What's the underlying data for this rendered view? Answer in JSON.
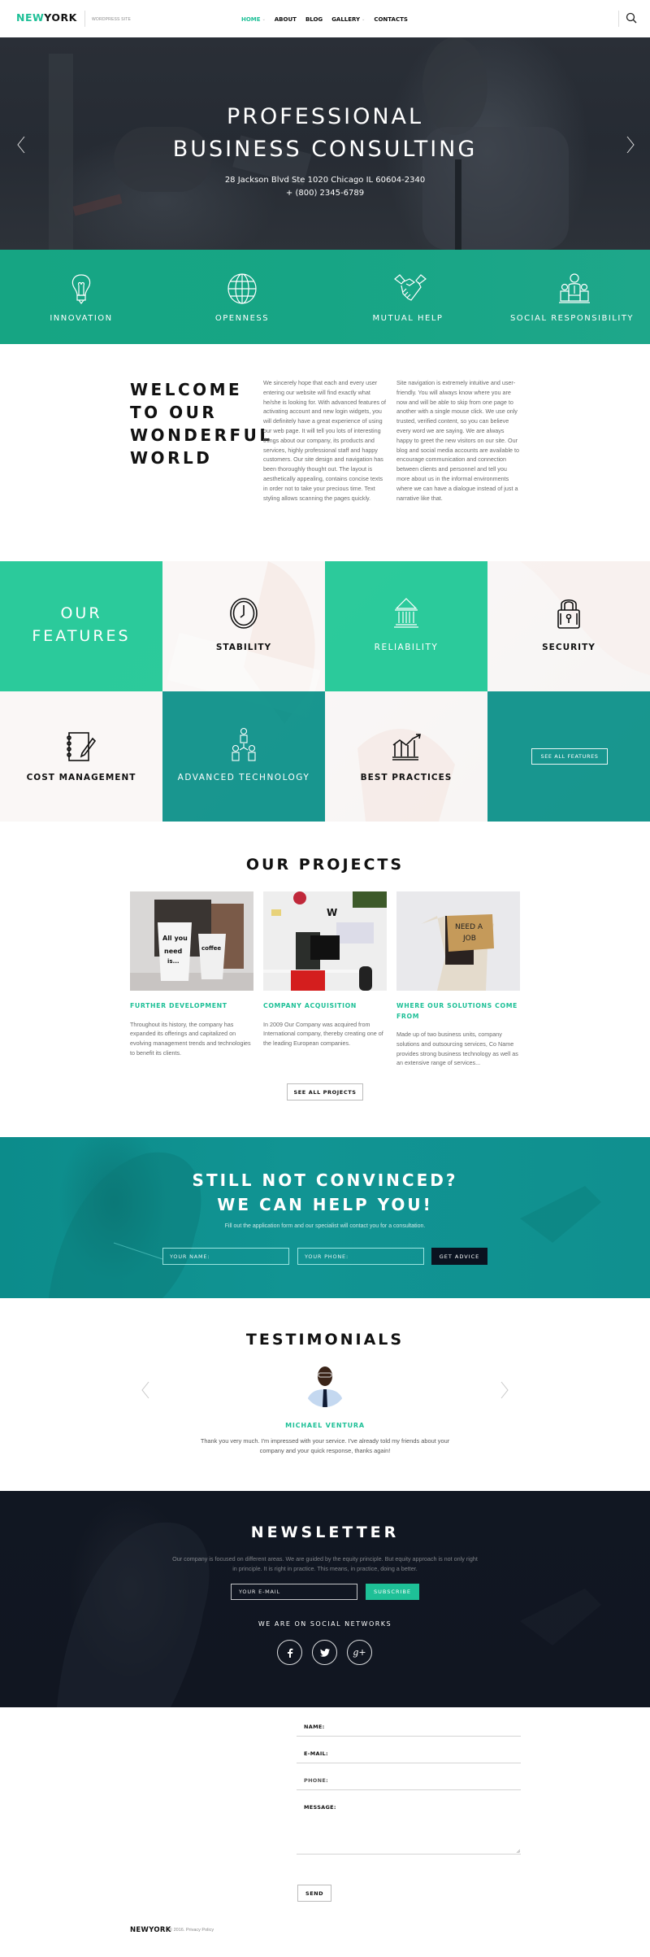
{
  "header": {
    "logo_accent": "NEW",
    "logo_main": "YORK",
    "tagline": "WORDPRESS SITE",
    "nav": [
      {
        "label": "HOME",
        "active": true,
        "has_dropdown": true
      },
      {
        "label": "ABOUT",
        "active": false,
        "has_dropdown": false
      },
      {
        "label": "BLOG",
        "active": false,
        "has_dropdown": false
      },
      {
        "label": "GALLERY",
        "active": false,
        "has_dropdown": true
      },
      {
        "label": "CONTACTS",
        "active": false,
        "has_dropdown": false
      }
    ],
    "search_icon": "search-icon"
  },
  "hero": {
    "title_line1": "PROFESSIONAL",
    "title_line2": "BUSINESS CONSULTING",
    "address": "28 Jackson Blvd Ste 1020 Chicago IL 60604-2340",
    "phone": "+ (800) 2345-6789",
    "prev_icon": "chevron-left-icon",
    "next_icon": "chevron-right-icon"
  },
  "values": [
    {
      "label": "INNOVATION",
      "icon": "lightbulb-icon"
    },
    {
      "label": "OPENNESS",
      "icon": "globe-icon"
    },
    {
      "label": "MUTUAL HELP",
      "icon": "handshake-icon"
    },
    {
      "label": "SOCIAL RESPONSIBILITY",
      "icon": "people-icon"
    }
  ],
  "welcome": {
    "title": "WELCOME\nTO OUR\nWONDERFUL\nWORLD",
    "col1": "We sincerely hope that each and every user entering our website will find exactly what he/she is looking for. With advanced features of activating account and new login widgets, you will definitely have a great experience of using our web page. It will tell you lots of interesting things about our company, its products and services, highly professional staff and happy customers. Our site design and navigation has been thoroughly thought out. The layout is aesthetically appealing, contains concise texts in order not to take your precious time. Text styling allows scanning the pages quickly.",
    "col2": "Site navigation is extremely intuitive and user-friendly. You will always know where you are now and will be able to skip from one page to another with a single mouse click. We use only trusted, verified content, so you can believe every word we are saying. We are always happy to greet the new visitors on our site. Our blog and social media accounts are available to encourage communication and connection between clients and personnel and tell you more about us in the informal environments where we can have a dialogue instead of just a narrative like that."
  },
  "features": {
    "title": "OUR\nFEATURES",
    "items": [
      {
        "label": "STABILITY",
        "icon": "clock-icon"
      },
      {
        "label": "RELIABILITY",
        "icon": "bank-icon"
      },
      {
        "label": "SECURITY",
        "icon": "padlock-icon"
      },
      {
        "label": "COST MANAGEMENT",
        "icon": "notebook-pen-icon"
      },
      {
        "label": "ADVANCED TECHNOLOGY",
        "icon": "team-network-icon"
      },
      {
        "label": "BEST PRACTICES",
        "icon": "growth-chart-icon"
      }
    ],
    "see_all": "SEE ALL FEATURES"
  },
  "projects": {
    "title": "OUR PROJECTS",
    "items": [
      {
        "title": "FURTHER DEVELOPMENT",
        "text": "Throughout its history, the company has expanded its offerings and capitalized on evolving management trends and technologies to benefit its clients.",
        "image": "coffee-mugs-photo"
      },
      {
        "title": "COMPANY ACQUISITION",
        "text": "In 2009 Our Company was acquired from International company, thereby creating one of the leading European companies.",
        "image": "workspace-photo"
      },
      {
        "title": "WHERE OUR SOLUTIONS COME FROM",
        "text": "Made up of two business units, company solutions and outsourcing services, Co Name provides strong business technology as well as an extensive range of services...",
        "image": "need-a-job-photo"
      }
    ],
    "mug_text_1": "All you need is...",
    "mug_text_2": "coffee",
    "sign_text": "NEED A JOB",
    "see_all": "SEE ALL PROJECTS"
  },
  "cta": {
    "title": "STILL NOT CONVINCED?\nWE CAN HELP YOU!",
    "subtitle": "Fill out the application form and our specialist will contact you for a consultation.",
    "name_placeholder": "YOUR NAME:",
    "phone_placeholder": "YOUR PHONE:",
    "button": "GET ADVICE"
  },
  "testimonials": {
    "title": "TESTIMONIALS",
    "name": "MICHAEL VENTURA",
    "quote": "Thank you very much. I'm impressed with your service. I've already told my friends about your company and your quick response, thanks again!"
  },
  "newsletter": {
    "title": "NEWSLETTER",
    "text": "Our company is focused on different areas. We are guided by the equity principle. But equity approach is not only right in principle. It is right in practice. This means, in practice, doing a better.",
    "email_placeholder": "YOUR E-MAIL",
    "button": "SUBSCRIBE",
    "social_title": "WE ARE ON SOCIAL NETWORKS",
    "social": [
      {
        "name": "facebook",
        "glyph": "f"
      },
      {
        "name": "twitter",
        "glyph": "t"
      },
      {
        "name": "google-plus",
        "glyph": "g+"
      }
    ]
  },
  "contact": {
    "name_label": "NAME:",
    "email_label": "E-MAIL:",
    "phone_label": "PHONE:",
    "message_label": "MESSAGE:",
    "send": "SEND"
  },
  "footer": {
    "logo": "NEWYORK",
    "copyright": "© 2016. Privacy Policy"
  },
  "colors": {
    "accent": "#1ec097",
    "teal": "#0c8c8b",
    "dark": "#111722"
  }
}
